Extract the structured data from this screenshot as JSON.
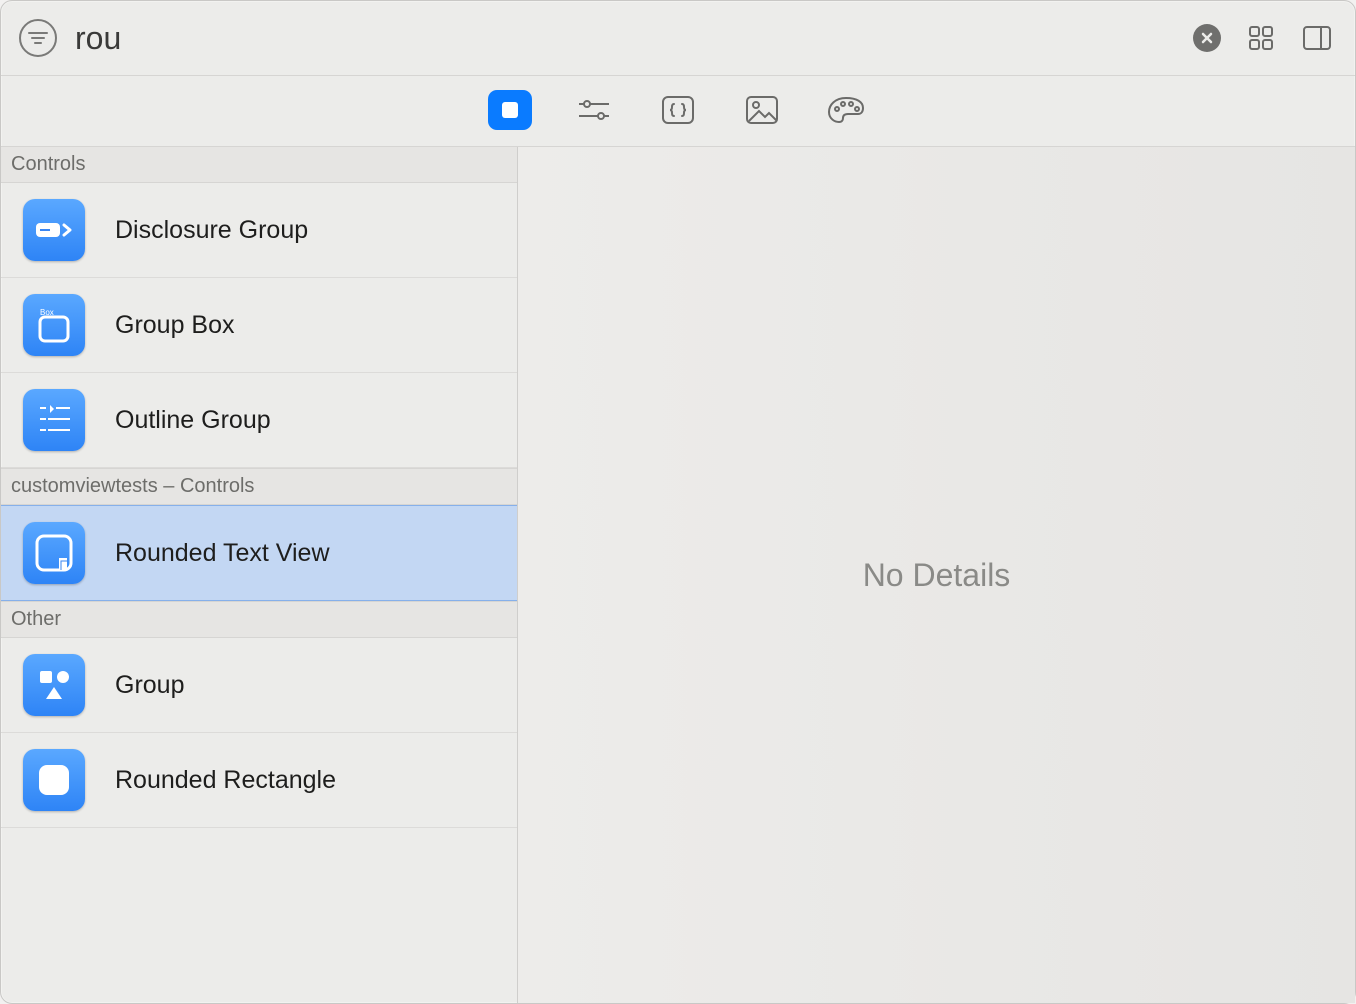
{
  "search": {
    "value": "rou"
  },
  "tabs": {
    "objects": "Objects",
    "modifiers": "Modifiers",
    "snippets": "Snippets",
    "media": "Media",
    "colors": "Colors"
  },
  "sections": [
    {
      "id": "controls",
      "title": "Controls",
      "items": [
        {
          "id": "disclosure-group",
          "label": "Disclosure Group",
          "icon": "disclosure"
        },
        {
          "id": "group-box",
          "label": "Group Box",
          "icon": "groupbox"
        },
        {
          "id": "outline-group",
          "label": "Outline Group",
          "icon": "outline"
        }
      ]
    },
    {
      "id": "custom-controls",
      "title": "customviewtests – Controls",
      "items": [
        {
          "id": "rounded-text-view",
          "label": "Rounded Text View",
          "icon": "roundedtextview",
          "selected": true
        }
      ]
    },
    {
      "id": "other",
      "title": "Other",
      "items": [
        {
          "id": "group",
          "label": "Group",
          "icon": "group"
        },
        {
          "id": "rounded-rectangle",
          "label": "Rounded Rectangle",
          "icon": "roundedrect"
        }
      ]
    }
  ],
  "detail": {
    "empty_text": "No Details"
  }
}
